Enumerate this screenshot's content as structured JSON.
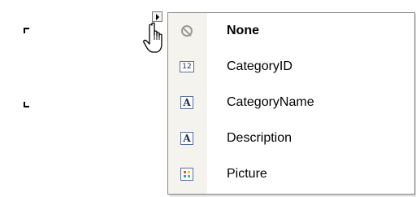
{
  "menu": {
    "items": [
      {
        "label": "None",
        "icon": "none-icon",
        "bold": true
      },
      {
        "label": "CategoryID",
        "icon": "number-field-icon",
        "icon_text": "12",
        "bold": false
      },
      {
        "label": "CategoryName",
        "icon": "text-field-icon",
        "icon_text": "A",
        "bold": false
      },
      {
        "label": "Description",
        "icon": "text-field-icon",
        "icon_text": "A",
        "bold": false
      },
      {
        "label": "Picture",
        "icon": "picture-field-icon",
        "bold": false
      }
    ]
  },
  "colors": {
    "gutter": "#f4f3ee",
    "border": "#8c8c8c",
    "icon_border": "#5a6e9a",
    "icon_text": "#1c2a66",
    "none_icon": "#9a9a9a"
  }
}
